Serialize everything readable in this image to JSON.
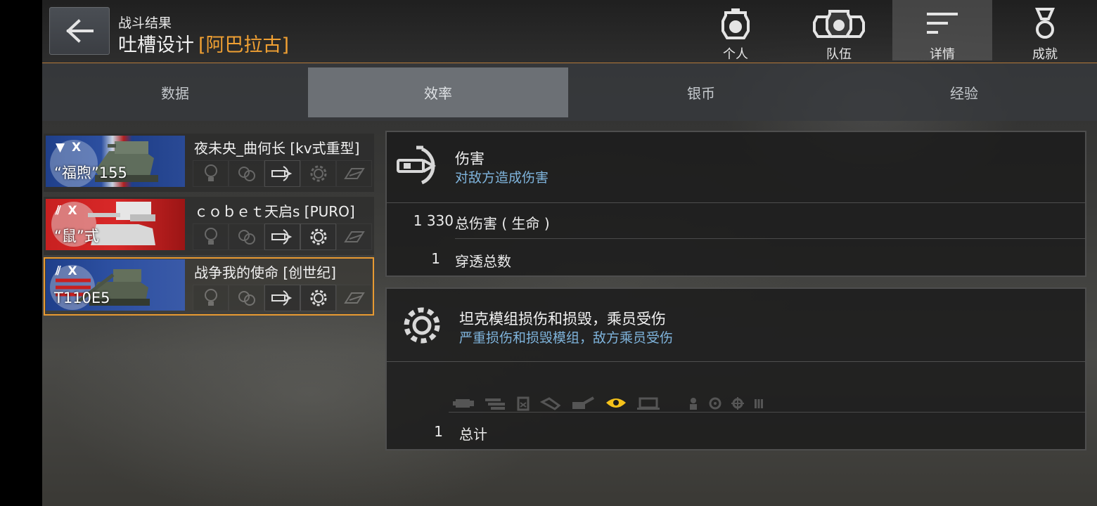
{
  "header": {
    "subtitle": "战斗结果",
    "map_name": "吐槽设计",
    "clan_tag": "[阿巴拉古]",
    "nav": [
      {
        "label": "个人",
        "icon": "personal-icon"
      },
      {
        "label": "队伍",
        "icon": "team-icon"
      },
      {
        "label": "详情",
        "icon": "details-icon",
        "active": true
      },
      {
        "label": "成就",
        "icon": "medal-icon"
      }
    ]
  },
  "tabs": [
    {
      "label": "数据"
    },
    {
      "label": "效率",
      "active": true
    },
    {
      "label": "银币"
    },
    {
      "label": "经验"
    }
  ],
  "players": [
    {
      "tier": "X",
      "tank": "“福煦”155",
      "name": "夜未央_曲何长 [kv式重型]"
    },
    {
      "tier": "X",
      "tank": "“鼠”式",
      "name": "ｃｏｂｅｔ天启s [PURO]"
    },
    {
      "tier": "X",
      "tank": "T110E5",
      "name": "战争我的使命 [创世纪]",
      "selected": true
    }
  ],
  "damage_panel": {
    "title": "伤害",
    "subtitle": "对敌方造成伤害",
    "rows": [
      {
        "value": "1 330",
        "label": "总伤害 ( 生命 )"
      },
      {
        "value": "1",
        "label": "穿透总数"
      }
    ]
  },
  "module_panel": {
    "title": "坦克模组损伤和损毁，乘员受伤",
    "subtitle": "严重损伤和损毁模组，敌方乘员受伤",
    "rows": [
      {
        "value": "1",
        "label": "总计"
      }
    ]
  },
  "colors": {
    "accent": "#e89a32",
    "subtitle_blue": "#7fb4dc",
    "active_module": "#f5c21a"
  }
}
